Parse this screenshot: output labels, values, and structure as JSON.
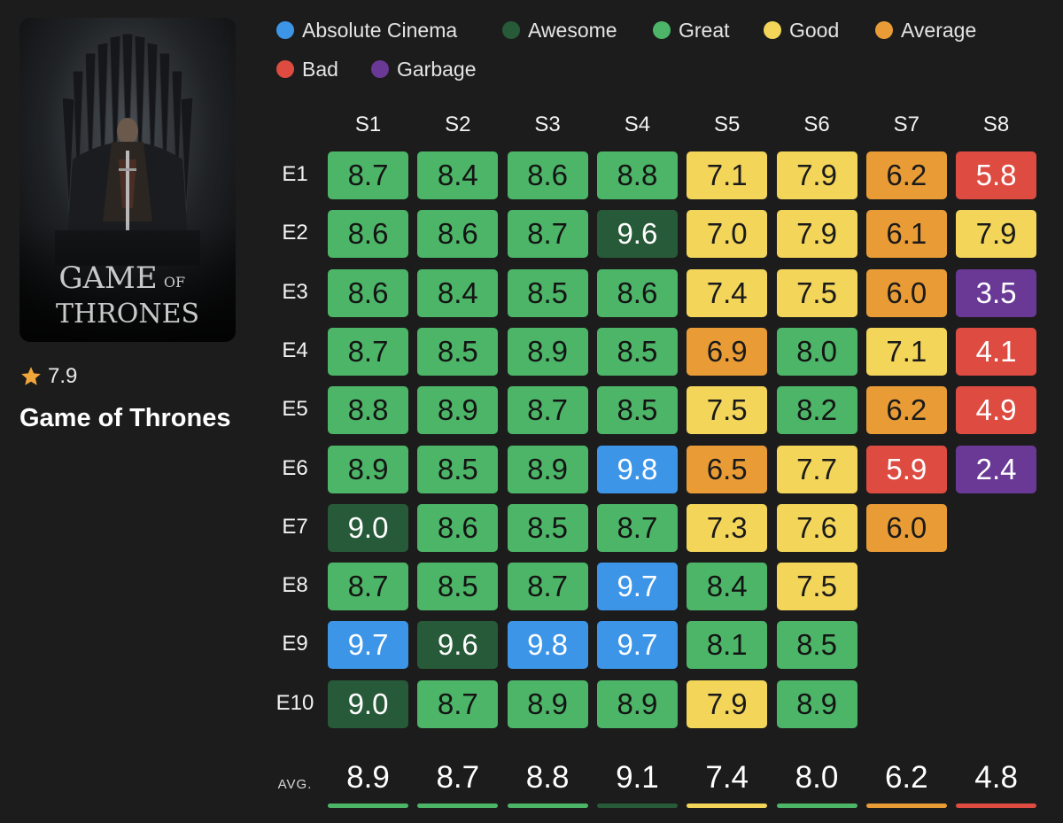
{
  "show": {
    "title": "Game of Thrones",
    "rating": "7.9",
    "poster_text": {
      "line1": "GAME",
      "of": "OF",
      "line2": "THRONES"
    }
  },
  "legend": [
    {
      "key": "absolute",
      "label": "Absolute Cinema",
      "color": "#3d95e8"
    },
    {
      "key": "awesome",
      "label": "Awesome",
      "color": "#275a38"
    },
    {
      "key": "great",
      "label": "Great",
      "color": "#4cb567"
    },
    {
      "key": "good",
      "label": "Good",
      "color": "#f3d559"
    },
    {
      "key": "average",
      "label": "Average",
      "color": "#e99c36"
    },
    {
      "key": "bad",
      "label": "Bad",
      "color": "#de4b41"
    },
    {
      "key": "garbage",
      "label": "Garbage",
      "color": "#6a3996"
    }
  ],
  "chart_data": {
    "type": "heatmap",
    "x": [
      "S1",
      "S2",
      "S3",
      "S4",
      "S5",
      "S6",
      "S7",
      "S8"
    ],
    "y": [
      "E1",
      "E2",
      "E3",
      "E4",
      "E5",
      "E6",
      "E7",
      "E8",
      "E9",
      "E10"
    ],
    "values": [
      [
        "8.7",
        "8.4",
        "8.6",
        "8.8",
        "7.1",
        "7.9",
        "6.2",
        "5.8"
      ],
      [
        "8.6",
        "8.6",
        "8.7",
        "9.6",
        "7.0",
        "7.9",
        "6.1",
        "7.9"
      ],
      [
        "8.6",
        "8.4",
        "8.5",
        "8.6",
        "7.4",
        "7.5",
        "6.0",
        "3.5"
      ],
      [
        "8.7",
        "8.5",
        "8.9",
        "8.5",
        "6.9",
        "8.0",
        "7.1",
        "4.1"
      ],
      [
        "8.8",
        "8.9",
        "8.7",
        "8.5",
        "7.5",
        "8.2",
        "6.2",
        "4.9"
      ],
      [
        "8.9",
        "8.5",
        "8.9",
        "9.8",
        "6.5",
        "7.7",
        "5.9",
        "2.4"
      ],
      [
        "9.0",
        "8.6",
        "8.5",
        "8.7",
        "7.3",
        "7.6",
        "6.0",
        null
      ],
      [
        "8.7",
        "8.5",
        "8.7",
        "9.7",
        "8.4",
        "7.5",
        null,
        null
      ],
      [
        "9.7",
        "9.6",
        "9.8",
        "9.7",
        "8.1",
        "8.5",
        null,
        null
      ],
      [
        "9.0",
        "8.7",
        "8.9",
        "8.9",
        "7.9",
        "8.9",
        null,
        null
      ]
    ],
    "categories": [
      [
        "great",
        "great",
        "great",
        "great",
        "good",
        "good",
        "average",
        "bad"
      ],
      [
        "great",
        "great",
        "great",
        "awesome",
        "good",
        "good",
        "average",
        "good"
      ],
      [
        "great",
        "great",
        "great",
        "great",
        "good",
        "good",
        "average",
        "garbage"
      ],
      [
        "great",
        "great",
        "great",
        "great",
        "average",
        "great",
        "good",
        "bad"
      ],
      [
        "great",
        "great",
        "great",
        "great",
        "good",
        "great",
        "average",
        "bad"
      ],
      [
        "great",
        "great",
        "great",
        "absolute",
        "average",
        "good",
        "bad",
        "garbage"
      ],
      [
        "awesome",
        "great",
        "great",
        "great",
        "good",
        "good",
        "average",
        null
      ],
      [
        "great",
        "great",
        "great",
        "absolute",
        "great",
        "good",
        null,
        null
      ],
      [
        "absolute",
        "awesome",
        "absolute",
        "absolute",
        "great",
        "great",
        null,
        null
      ],
      [
        "awesome",
        "great",
        "great",
        "great",
        "good",
        "great",
        null,
        null
      ]
    ],
    "avg_label": "AVG.",
    "averages": [
      "8.9",
      "8.7",
      "8.8",
      "9.1",
      "7.4",
      "8.0",
      "6.2",
      "4.8"
    ],
    "average_categories": [
      "great",
      "great",
      "great",
      "awesome",
      "good",
      "great",
      "average",
      "bad"
    ]
  }
}
